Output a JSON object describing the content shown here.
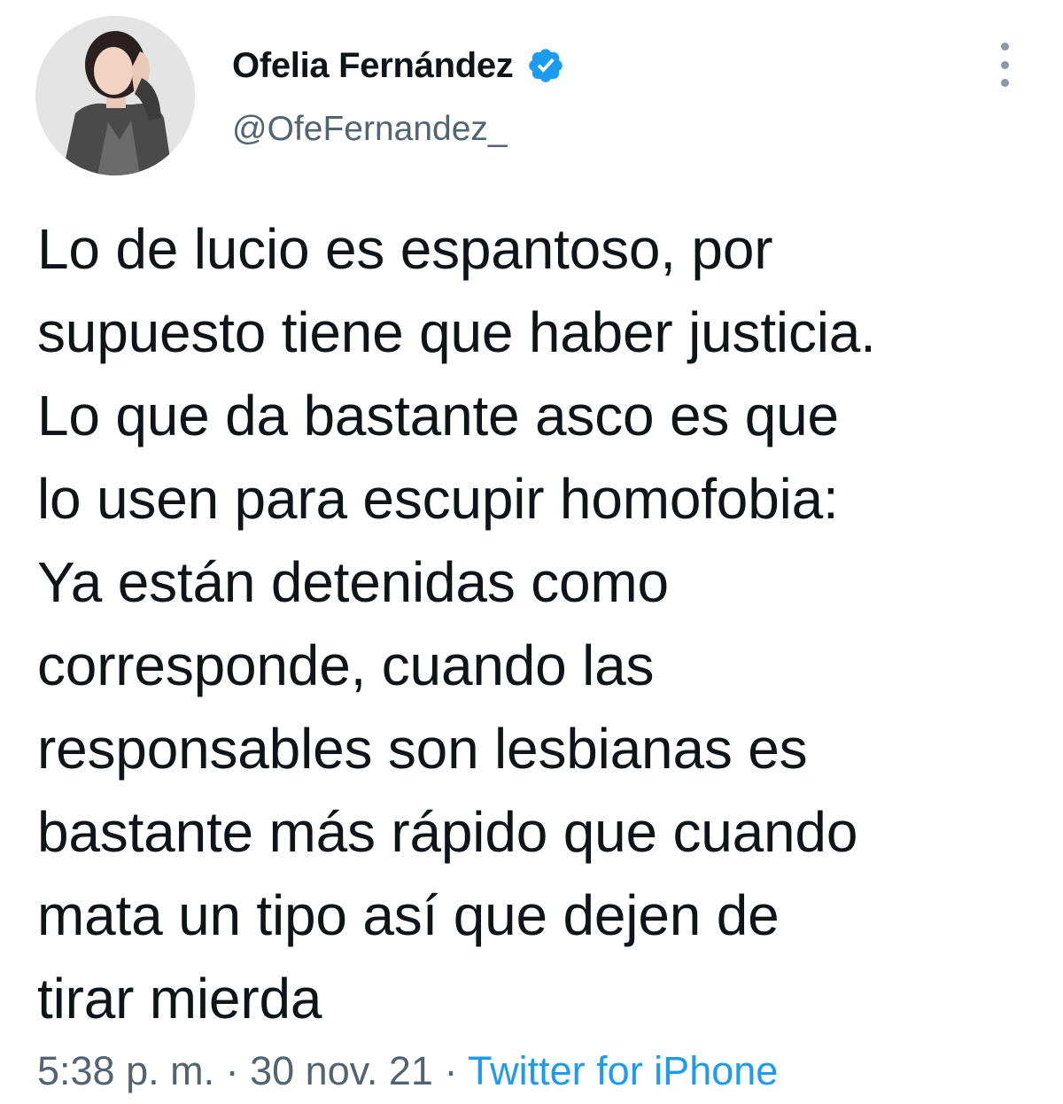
{
  "tweet": {
    "author": {
      "name": "Ofelia Fernández",
      "handle": "@OfeFernandez_",
      "verified_icon": "verified-badge-icon",
      "verified_color": "#1d9bf0"
    },
    "text_lines": [
      "Lo de lucio es espantoso, por",
      "supuesto tiene que haber justicia.",
      "Lo que da bastante asco es que",
      "lo usen para escupir homofobia:",
      "Ya están detenidas como",
      "corresponde, cuando las",
      "responsables son lesbianas es",
      "bastante más rápido que cuando",
      "mata un tipo así que dejen de",
      "tirar mierda"
    ],
    "meta": {
      "time": "5:38 p. m.",
      "separator": " · ",
      "date": "30 nov. 21",
      "source": "Twitter for iPhone"
    },
    "colors": {
      "text": "#0f1419",
      "secondary": "#536471",
      "link": "#1d9bf0"
    }
  }
}
